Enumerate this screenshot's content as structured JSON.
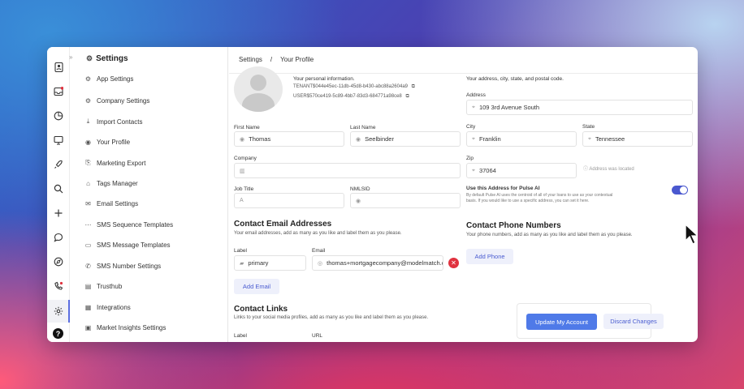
{
  "rail_icons": [
    "contacts-icon",
    "inbox-icon",
    "pie-chart-icon",
    "monitor-icon",
    "rocket-icon",
    "search-icon",
    "plus-icon",
    "chat-icon",
    "compass-icon",
    "phone-icon",
    "gear-icon",
    "help-icon"
  ],
  "colors": {
    "accent": "#5b6ee1",
    "primary_button": "#4f7ae8",
    "delete": "#e0323f"
  },
  "sidebar": {
    "title": "Settings",
    "items": [
      {
        "label": "App Settings",
        "icon": "gear-icon"
      },
      {
        "label": "Company Settings",
        "icon": "gear-icon"
      },
      {
        "label": "Import Contacts",
        "icon": "download-icon"
      },
      {
        "label": "Your Profile",
        "icon": "user-icon"
      },
      {
        "label": "Marketing Export",
        "icon": "export-icon"
      },
      {
        "label": "Tags Manager",
        "icon": "tag-icon"
      },
      {
        "label": "Email Settings",
        "icon": "mail-icon"
      },
      {
        "label": "SMS Sequence Templates",
        "icon": "sequence-icon"
      },
      {
        "label": "SMS Message Templates",
        "icon": "message-icon"
      },
      {
        "label": "SMS Number Settings",
        "icon": "phone-icon"
      },
      {
        "label": "Trusthub",
        "icon": "document-icon"
      },
      {
        "label": "Integrations",
        "icon": "grid-icon"
      },
      {
        "label": "Market Insights Settings",
        "icon": "chart-icon"
      }
    ]
  },
  "breadcrumb": {
    "root": "Settings",
    "sep": "/",
    "current": "Your Profile"
  },
  "profile": {
    "personal_info_label": "Your personal information.",
    "tenant_id": "TENANT$044e45ec-11db-45d8-b430-abc88a2604a9",
    "user_id": "USER$570ce419-5c89-4bb7-83d3-684771a98ce8"
  },
  "fields": {
    "first_name_label": "First Name",
    "first_name": "Thomas",
    "last_name_label": "Last Name",
    "last_name": "Seelbinder",
    "company_label": "Company",
    "company": "",
    "job_title_label": "Job Title",
    "job_title": "",
    "nmlsid_label": "NMLSID",
    "nmlsid": ""
  },
  "contact_email": {
    "title": "Contact Email Addresses",
    "desc": "Your email addresses, add as many as you like and label them as you please.",
    "label_header": "Label",
    "email_header": "Email",
    "label_value": "primary",
    "email_value": "thomas+mortgagecompany@modelmatch.com",
    "add_button": "Add Email"
  },
  "contact_links": {
    "title": "Contact Links",
    "desc": "Links to your social media profiles, add as many as you like and label them as you please.",
    "label_header": "Label",
    "url_header": "URL"
  },
  "address": {
    "desc": "Your address, city, state, and postal code.",
    "address_label": "Address",
    "address": "109 3rd Avenue South",
    "city_label": "City",
    "city": "Franklin",
    "state_label": "State",
    "state": "Tennessee",
    "zip_label": "Zip",
    "zip": "37064",
    "located_note": "Address was located",
    "pulse_title": "Use this Address for Pulse AI",
    "pulse_desc": "By default Pulse AI uses the centroid of all of your loans to use as your contextual basis. If you would like to use a specific address, you can set it here.",
    "pulse_enabled": true
  },
  "contact_phone": {
    "title": "Contact Phone Numbers",
    "desc": "Your phone numbers, add as many as you like and label them as you please.",
    "add_button": "Add Phone"
  },
  "footer": {
    "update": "Update My Account",
    "discard": "Discard Changes"
  }
}
